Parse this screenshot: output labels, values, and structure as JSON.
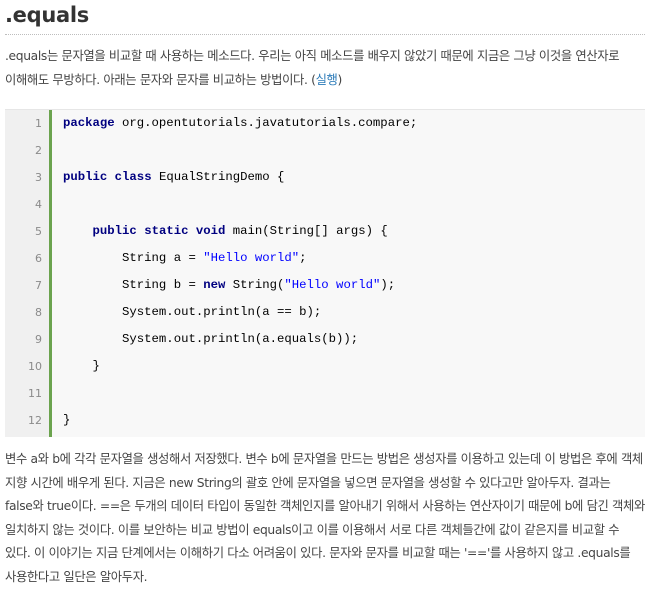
{
  "heading": ".equals",
  "intro": {
    "text": ".equals는 문자열을 비교할 때 사용하는 메소드다. 우리는 아직 메소드를 배우지 않았기 때문에 지금은 그냥 이것을 연산자로 이해해도 무방하다. 아래는 문자와 문자를 비교하는 방법이다. (",
    "link": "실행",
    "after": ")"
  },
  "code": {
    "colors": {
      "keyword": "#000080",
      "string": "#0000ff",
      "gutter_border": "#6ba34e"
    },
    "lines": [
      {
        "no": "1",
        "tokens": [
          {
            "t": "package",
            "k": "kw"
          },
          {
            "t": " org.opentutorials.javatutorials.compare;"
          }
        ]
      },
      {
        "no": "2",
        "tokens": []
      },
      {
        "no": "3",
        "tokens": [
          {
            "t": "public",
            "k": "kw"
          },
          {
            "t": " "
          },
          {
            "t": "class",
            "k": "kw"
          },
          {
            "t": " EqualStringDemo {"
          }
        ]
      },
      {
        "no": "4",
        "tokens": []
      },
      {
        "no": "5",
        "tokens": [
          {
            "t": "    "
          },
          {
            "t": "public",
            "k": "kw"
          },
          {
            "t": " "
          },
          {
            "t": "static",
            "k": "kw"
          },
          {
            "t": " "
          },
          {
            "t": "void",
            "k": "kw"
          },
          {
            "t": " main(String[] args) {"
          }
        ]
      },
      {
        "no": "6",
        "tokens": [
          {
            "t": "        String a = "
          },
          {
            "t": "\"Hello world\"",
            "k": "str"
          },
          {
            "t": ";"
          }
        ]
      },
      {
        "no": "7",
        "tokens": [
          {
            "t": "        String b = "
          },
          {
            "t": "new",
            "k": "kw"
          },
          {
            "t": " String("
          },
          {
            "t": "\"Hello world\"",
            "k": "str"
          },
          {
            "t": ");"
          }
        ]
      },
      {
        "no": "8",
        "tokens": [
          {
            "t": "        System.out.println(a == b);"
          }
        ]
      },
      {
        "no": "9",
        "tokens": [
          {
            "t": "        System.out.println(a.equals(b));"
          }
        ]
      },
      {
        "no": "10",
        "tokens": [
          {
            "t": "    }"
          }
        ]
      },
      {
        "no": "11",
        "tokens": []
      },
      {
        "no": "12",
        "tokens": [
          {
            "t": "}"
          }
        ]
      }
    ]
  },
  "explanation": "변수 a와 b에 각각 문자열을 생성해서 저장했다. 변수 b에 문자열을 만드는 방법은 생성자를 이용하고 있는데 이 방법은 후에 객체 지향 시간에 배우게 된다. 지금은 new String의 괄호 안에 문자열을 넣으면 문자열을 생성할 수 있다고만 알아두자. 결과는 false와 true이다. ==은 두개의 데이터 타입이 동일한 객체인지를 알아내기 위해서 사용하는 연산자이기 때문에 b에 담긴 객체와 일치하지 않는 것이다. 이를 보안하는 비교 방법이 equals이고 이를 이용해서 서로 다른 객체들간에 값이 같은지를 비교할 수 있다. 이 이야기는 지금 단계에서는 이해하기 다소 어려움이 있다. 문자와 문자를 비교할 때는 '=='를 사용하지 않고 .equals를 사용한다고 일단은 알아두자."
}
